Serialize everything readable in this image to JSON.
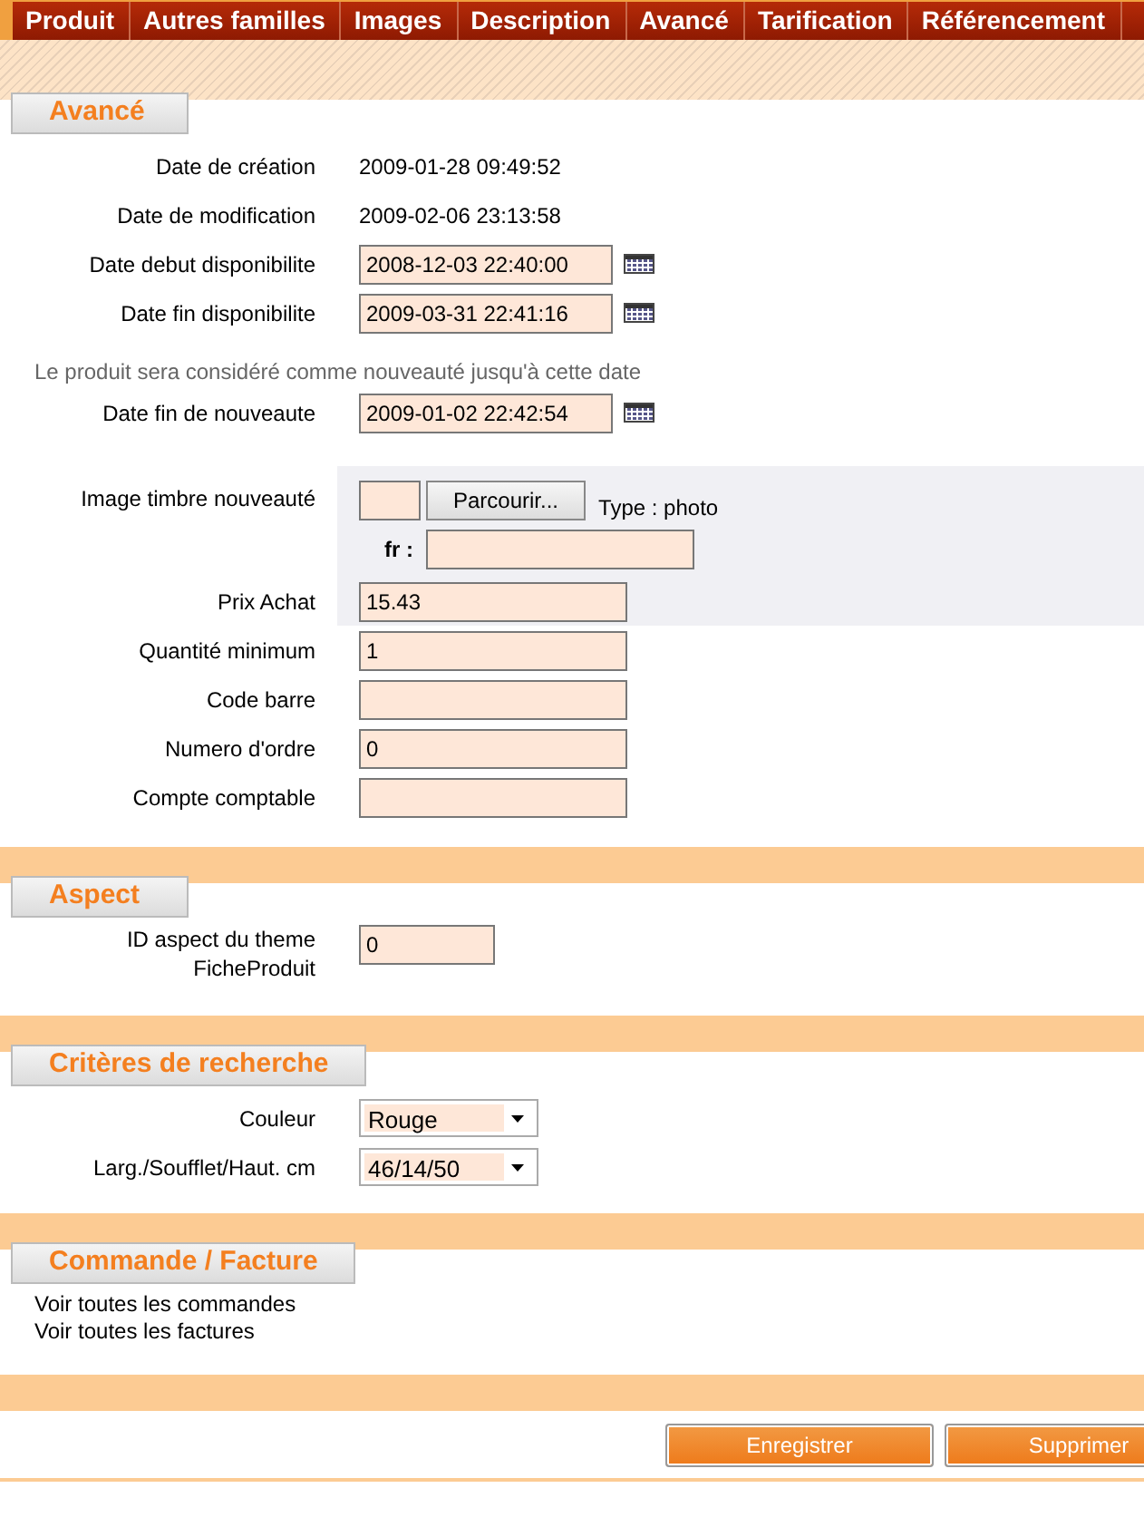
{
  "tabs": [
    {
      "label": "Produit"
    },
    {
      "label": "Autres familles"
    },
    {
      "label": "Images"
    },
    {
      "label": "Description"
    },
    {
      "label": "Avancé"
    },
    {
      "label": "Tarification"
    },
    {
      "label": "Référencement"
    }
  ],
  "sections": [
    {
      "title": "Avancé",
      "rows": [
        {
          "kind": "text",
          "label": "Date de création",
          "value": "2009-01-28 09:49:52",
          "shaded": false
        },
        {
          "kind": "text",
          "label": "Date de modification",
          "value": "2009-02-06 23:13:58",
          "shaded": false
        },
        {
          "kind": "date",
          "label": "Date debut disponibilite",
          "value": "2008-12-03 22:40:00",
          "shaded": false
        },
        {
          "kind": "date",
          "label": "Date fin disponibilite",
          "value": "2009-03-31 22:41:16",
          "shaded": false
        },
        {
          "kind": "note",
          "label": "Le produit sera considéré comme nouveauté jusqu'à cette date",
          "shaded": false
        },
        {
          "kind": "date",
          "label": "Date fin de nouveaute",
          "value": "2009-01-02 22:42:54",
          "shaded": false
        },
        {
          "kind": "file",
          "label": "Image timbre nouveauté",
          "button": "Parcourir...",
          "type_label": "Type : photo",
          "lang": "fr :",
          "shaded": true
        },
        {
          "kind": "input",
          "label": "Prix Achat",
          "value": "15.43",
          "shaded": true
        },
        {
          "kind": "input",
          "label": "Quantité minimum",
          "value": "1",
          "shaded": false
        },
        {
          "kind": "input",
          "label": "Code barre",
          "shaded": false
        },
        {
          "kind": "input",
          "label": "Numero d'ordre",
          "value": "0",
          "shaded": false
        },
        {
          "kind": "input",
          "label": "Compte comptable",
          "shaded": false
        }
      ]
    },
    {
      "title": "Aspect",
      "rows": [
        {
          "kind": "small",
          "label": "ID aspect du theme FicheProduit",
          "value": "0",
          "shaded": false
        }
      ]
    },
    {
      "title": "Critères de recherche",
      "rows": [
        {
          "kind": "select",
          "label": "Couleur",
          "value": "Rouge",
          "shaded": false
        },
        {
          "kind": "select",
          "label": "Larg./Soufflet/Haut. cm",
          "value": "46/14/50",
          "shaded": false
        }
      ]
    },
    {
      "title": "Commande / Facture",
      "links": [
        "Voir toutes les commandes",
        "Voir toutes les factures"
      ]
    }
  ],
  "buttons": [
    "Enregistrer",
    "Supprimer"
  ]
}
